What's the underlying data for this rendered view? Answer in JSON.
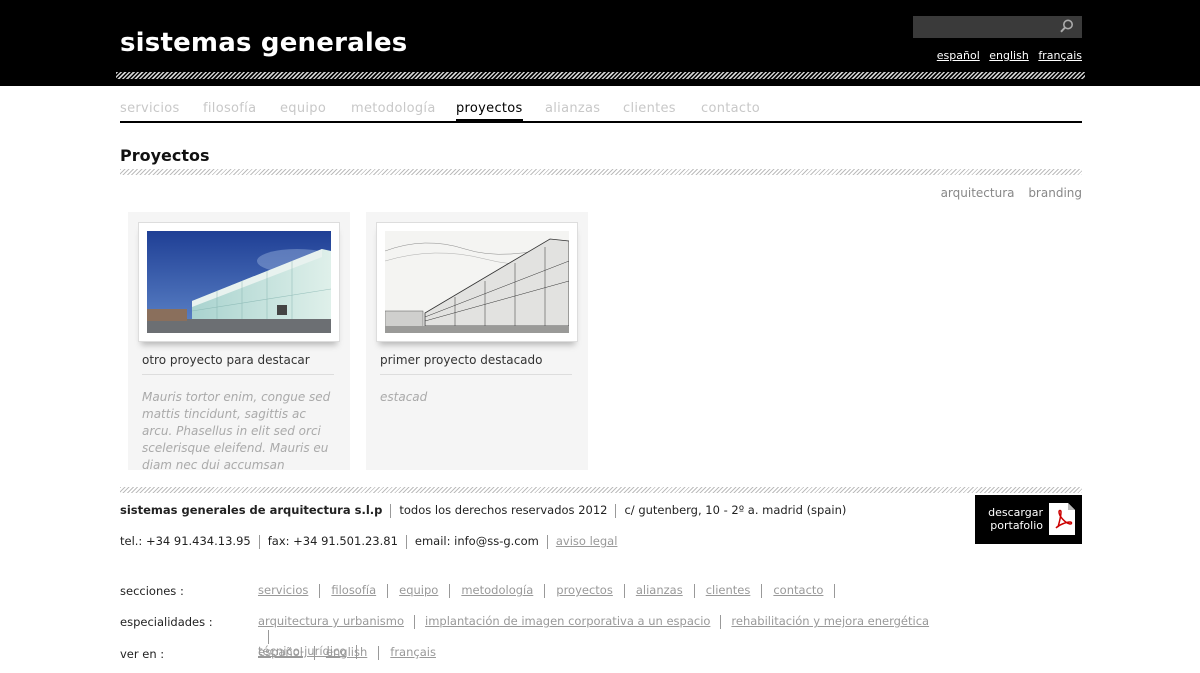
{
  "header": {
    "site_title": "sistemas generales",
    "search_placeholder": "",
    "languages": [
      "español",
      "english",
      "français"
    ]
  },
  "nav": {
    "items": [
      "servicios",
      "filosofía",
      "equipo",
      "metodología",
      "proyectos",
      "alianzas",
      "clientes",
      "contacto"
    ],
    "active": "proyectos"
  },
  "main": {
    "page_title": "Proyectos",
    "filters": [
      "arquitectura",
      "branding"
    ],
    "cards": [
      {
        "title": "otro proyecto para destacar",
        "description": "Mauris tortor enim, congue sed mattis tincidunt, sagittis ac arcu. Phasellus in elit sed orci scelerisque eleifend. Mauris eu diam nec dui accumsan pharetra"
      },
      {
        "title": "primer proyecto destacado",
        "description": "estacad"
      }
    ]
  },
  "footer": {
    "company": "sistemas generales de arquitectura s.l.p",
    "rights": "todos los derechos reservados 2012",
    "address": "c/ gutenberg, 10 - 2º a. madrid (spain)",
    "tel": "tel.: +34 91.434.13.95",
    "fax": "fax: +34 91.501.23.81",
    "email": "email: info@ss-g.com",
    "legal": "aviso legal",
    "pdf_button": "descargar portafolio",
    "sitemap": {
      "secciones_label": "secciones :",
      "secciones": [
        "servicios",
        "filosofía",
        "equipo",
        "metodología",
        "proyectos",
        "alianzas",
        "clientes",
        "contacto"
      ],
      "especialidades_label": "especialidades :",
      "especialidades": [
        "arquitectura y urbanismo",
        "implantación de imagen corporativa a un espacio",
        "rehabilitación y mejora energética",
        "técnico-jurídico"
      ],
      "ver_label": "ver en :",
      "ver": [
        "español",
        "english",
        "français"
      ]
    }
  }
}
